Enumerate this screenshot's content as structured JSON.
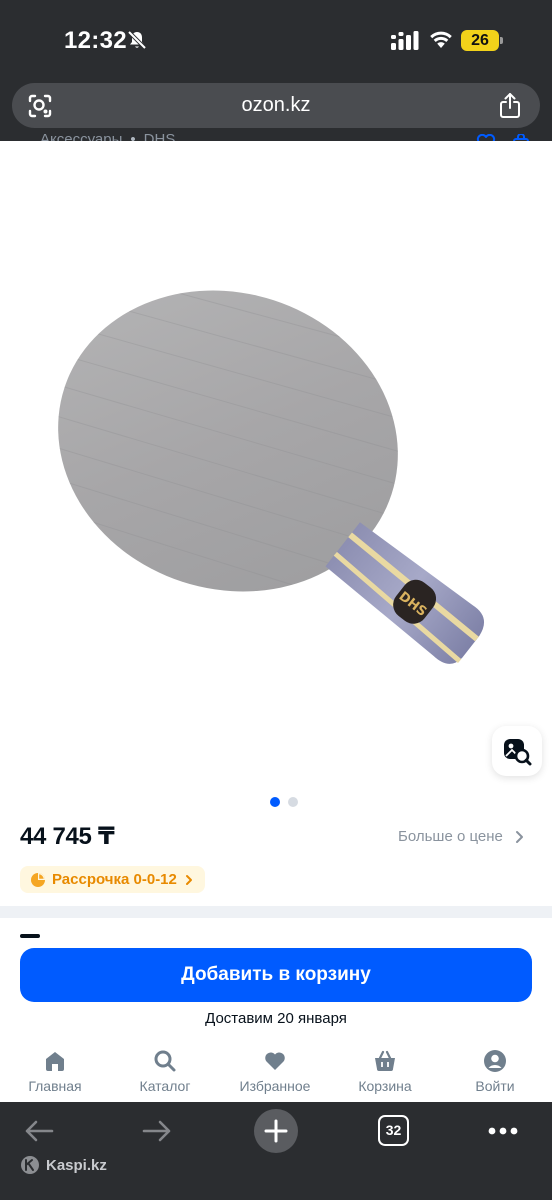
{
  "status_bar": {
    "time": "12:32",
    "battery": "26"
  },
  "browser": {
    "url": "ozon.kz",
    "tabs_count": "32",
    "site_label": "Kaspi.kz"
  },
  "breadcrumb": [
    "Аксессуары",
    "DHS"
  ],
  "product": {
    "price": "44 745 ₸",
    "more_price_label": "Больше о цене",
    "installment_label": "Рассрочка 0-0-12",
    "gallery_index": 1,
    "gallery_total": 2
  },
  "actions": {
    "add_to_cart": "Добавить в корзину",
    "delivery": "Доставим 20 января"
  },
  "bottom_nav": [
    {
      "label": "Главная",
      "icon": "home-icon"
    },
    {
      "label": "Каталог",
      "icon": "search-icon"
    },
    {
      "label": "Избранное",
      "icon": "heart-icon"
    },
    {
      "label": "Корзина",
      "icon": "basket-icon"
    },
    {
      "label": "Войти",
      "icon": "user-icon"
    }
  ],
  "colors": {
    "accent": "#005bff",
    "installment": "#e88a00",
    "chrome": "#2b2d30"
  }
}
